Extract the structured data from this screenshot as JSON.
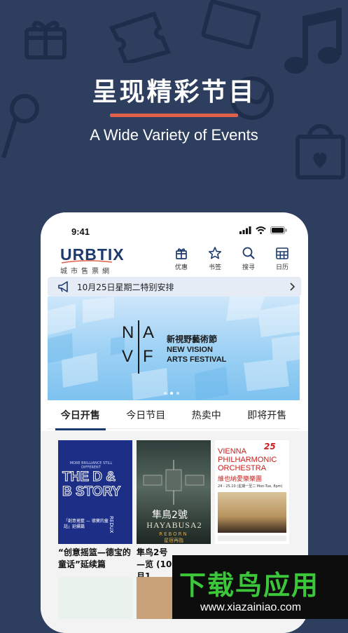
{
  "headline": "呈现精彩节目",
  "subheadline": "A Wide Variety of Events",
  "phone": {
    "status_time": "9:41",
    "logo": {
      "name": "URBTIX",
      "sub": "城市售票網"
    },
    "nav": [
      {
        "label": "优惠",
        "icon": "gift-box-icon"
      },
      {
        "label": "书签",
        "icon": "star-icon"
      },
      {
        "label": "搜寻",
        "icon": "search-icon"
      },
      {
        "label": "日历",
        "icon": "calendar-icon"
      }
    ],
    "notice": "10月25日星期二特别安排",
    "banner": {
      "letters": [
        "N",
        "V",
        "A",
        "F"
      ],
      "title_zh": "新視野藝術節",
      "title_en_1": "NEW VISION",
      "title_en_2": "ARTS FESTIVAL",
      "dots": 3,
      "active_dot": 1
    },
    "tabs": [
      "今日开售",
      "今日节目",
      "热卖中",
      "即将开售"
    ],
    "active_tab": 0,
    "posters": [
      {
        "tagline": "MORE BRILLIANCE STILL DIFFERENT",
        "title": "THE D & B STORY",
        "vertical": "REDUX",
        "sub": "「創意搖籃 — 德寶的童話」延續篇",
        "caption": "“创意摇篮—德宝的童话”延续篇"
      },
      {
        "title_zh": "隼鳥2號",
        "title_en": "HAYABUSA2",
        "sub_en": "REBORN",
        "sub_zh": "星宿再臨",
        "caption": "隼鸟2号—览 (10月1"
      },
      {
        "line1": "VIENNA",
        "line2": "PHILHARMONIC",
        "line3": "ORCHESTRA",
        "zh": "維也納愛樂樂團",
        "badge": "25",
        "dates": "24 - 25.10 (星期一至二 Mon-Tue, 8pm)"
      }
    ]
  },
  "watermark": {
    "text": "下载鸟应用",
    "url": "www.xiazainiao.com"
  },
  "colors": {
    "background": "#2d3e5f",
    "accent": "#e0604a",
    "brand": "#1d3a6e",
    "watermark_green": "#3cc73a"
  }
}
